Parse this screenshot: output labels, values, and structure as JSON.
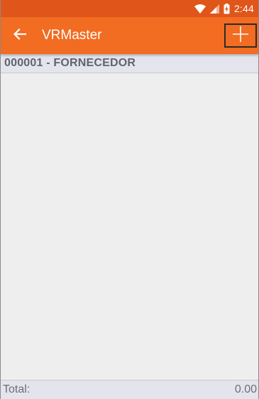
{
  "status_bar": {
    "time": "2:44",
    "icons": [
      "wifi-icon",
      "cell-signal-icon",
      "battery-charging-icon"
    ]
  },
  "app_bar": {
    "back_icon": "arrow-back-icon",
    "title": "VRMaster",
    "add_icon": "plus-icon"
  },
  "header": {
    "label": "000001 - FORNECEDOR"
  },
  "list": {
    "items": []
  },
  "footer": {
    "total_label": "Total:",
    "total_value": "0.00"
  },
  "colors": {
    "status_bar": "#e0561a",
    "app_bar": "#f26c21",
    "background": "#eeeeee",
    "header_bg": "#e4e4ec",
    "header_text": "#5f6470"
  }
}
